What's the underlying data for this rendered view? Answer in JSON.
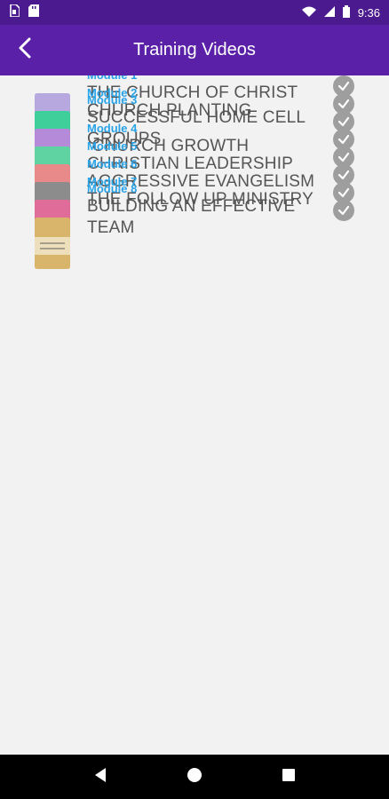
{
  "status_bar": {
    "time": "9:36",
    "icons": [
      "sim-icon",
      "sd-card-icon",
      "wifi-icon",
      "signal-icon",
      "battery-icon"
    ]
  },
  "app_bar": {
    "title": "Training Videos",
    "back_icon": "back-arrow-icon"
  },
  "colors": {
    "app_bar": "#5a21a8",
    "status_bar": "#4a1a8e",
    "module_label": "#29a3e8",
    "title_text": "#555555",
    "check": "#9e9e9e"
  },
  "modules": [
    {
      "label": "Module 1",
      "title": "THE CHURCH OF CHRIST",
      "completed": true,
      "thumb_color": "#b7a8e0"
    },
    {
      "label": "Module 2",
      "title": "CHURCH PLANTING",
      "completed": true,
      "thumb_color": "#3fcf9a"
    },
    {
      "label": "Module 3",
      "title": "SUCCESSFUL HOME CELL GROUPS",
      "completed": true,
      "thumb_color": "#b58ad8"
    },
    {
      "label": "Module 4",
      "title": " CHURCH GROWTH",
      "completed": true,
      "thumb_color": "#5fd3a2"
    },
    {
      "label": "Module 5",
      "title": "CHRISTIAN LEADERSHIP",
      "completed": true,
      "thumb_color": "#e88a8a"
    },
    {
      "label": "Module 6",
      "title": "AGGRESSIVE EVANGELISM",
      "completed": true,
      "thumb_color": "#8c8c8c"
    },
    {
      "label": "Module 7",
      "title": "THE FOLLOW UP MINISTRY",
      "completed": true,
      "thumb_color": "#e06c9a"
    },
    {
      "label": "Module 8",
      "title": "BUILDING AN EFFECTIVE TEAM",
      "completed": true,
      "thumb_color": "#d8b56a"
    }
  ],
  "nav_bar": {
    "icons": [
      "back-triangle-icon",
      "home-circle-icon",
      "recents-square-icon"
    ]
  }
}
